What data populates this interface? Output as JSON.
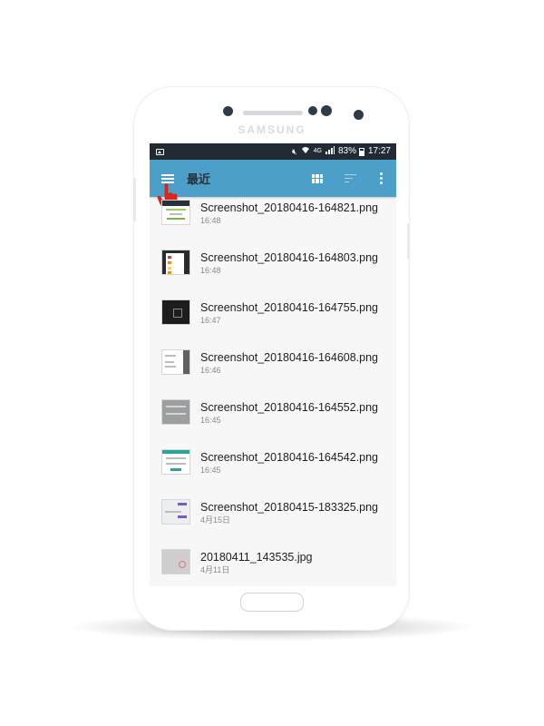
{
  "device": {
    "brand": "SAMSUNG"
  },
  "status_bar": {
    "battery": "83%",
    "time": "17:27",
    "network": "4G"
  },
  "toolbar": {
    "title": "最近",
    "color": "#4c9fc9"
  },
  "files": [
    {
      "name": "Screenshot_20180416-164821.png",
      "time": "16:48"
    },
    {
      "name": "Screenshot_20180416-164803.png",
      "time": "16:48"
    },
    {
      "name": "Screenshot_20180416-164755.png",
      "time": "16:47"
    },
    {
      "name": "Screenshot_20180416-164608.png",
      "time": "16:46"
    },
    {
      "name": "Screenshot_20180416-164552.png",
      "time": "16:45"
    },
    {
      "name": "Screenshot_20180416-164542.png",
      "time": "16:45"
    },
    {
      "name": "Screenshot_20180415-183325.png",
      "time": "4月15日"
    },
    {
      "name": "20180411_143535.jpg",
      "time": "4月11日"
    }
  ],
  "icons": [
    "menu-icon",
    "grid-view-icon",
    "sort-icon",
    "more-options-icon",
    "pointer-hand-icon",
    "image-icon",
    "mute-icon",
    "wifi-icon",
    "signal-icon",
    "battery-icon"
  ]
}
